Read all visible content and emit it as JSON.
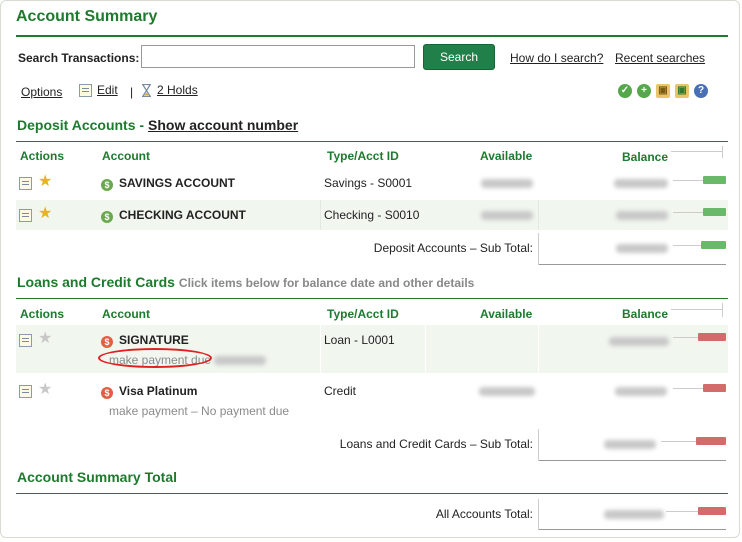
{
  "page": {
    "title": "Account Summary"
  },
  "search": {
    "label": "Search Transactions:",
    "value": "",
    "placeholder": "",
    "button_label": "Search",
    "help_link": "How do I search?",
    "recent_link": "Recent searches"
  },
  "links": {
    "options": "Options",
    "edit": "Edit",
    "separator": "|",
    "holds": "2 Holds"
  },
  "toolbar_icons": [
    "check-icon",
    "add-icon",
    "package-icon",
    "package-add-icon",
    "help-icon"
  ],
  "deposit": {
    "title": "Deposit Accounts -",
    "show_link": "Show account number",
    "headers": {
      "actions": "Actions",
      "account": "Account",
      "type": "Type/Acct ID",
      "available": "Available",
      "balance": "Balance"
    },
    "rows": [
      {
        "name": "SAVINGS ACCOUNT",
        "type": "Savings - S0001",
        "favorite": true,
        "bar_fill": 0.45
      },
      {
        "name": "CHECKING ACCOUNT",
        "type": "Checking - S0010",
        "favorite": true,
        "bar_fill": 0.45
      }
    ],
    "subtotal_label": "Deposit Accounts – Sub Total:",
    "subtotal_bar_fill": 0.5
  },
  "loans": {
    "title": "Loans and Credit Cards",
    "hint": "Click items below for balance date and other details",
    "headers": {
      "actions": "Actions",
      "account": "Account",
      "type": "Type/Acct ID",
      "available": "Available",
      "balance": "Balance"
    },
    "rows": [
      {
        "name": "SIGNATURE",
        "type": "Loan - L0001",
        "favorite": false,
        "payment_link": "make payment",
        "payment_note": "due",
        "bar_fill": 0.55
      },
      {
        "name": "Visa Platinum",
        "type": "Credit",
        "favorite": false,
        "payment_link": "make payment",
        "payment_note": "– No payment due",
        "bar_fill": 0.45
      }
    ],
    "subtotal_label": "Loans and Credit Cards – Sub Total:",
    "subtotal_bar_fill": 0.6
  },
  "summary": {
    "title": "Account Summary Total",
    "total_label": "All Accounts Total:",
    "total_bar_fill": 0.55
  },
  "colors": {
    "accent": "#1e7a2e",
    "button": "#21804a",
    "positive_bar": "#6ab86a",
    "negative_bar": "#d46b6b",
    "annotation": "#e02020"
  }
}
